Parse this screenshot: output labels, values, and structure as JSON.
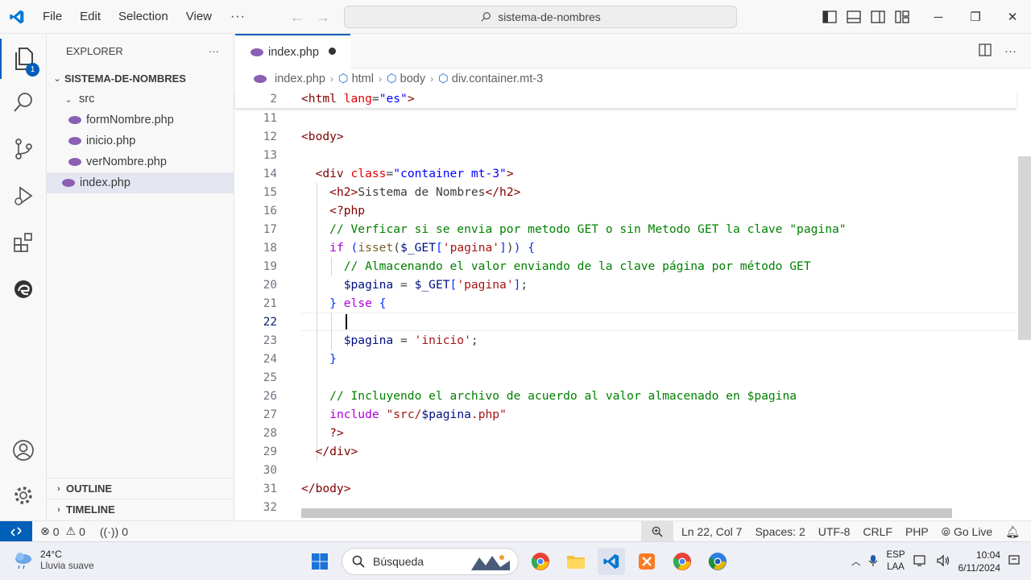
{
  "titlebar": {
    "menu": [
      "File",
      "Edit",
      "Selection",
      "View"
    ],
    "more": "···",
    "search_text": "sistema-de-nombres"
  },
  "activity": {
    "explorer_badge": "1"
  },
  "sidebar": {
    "header": "EXPLORER",
    "header_more": "···",
    "root": "SISTEMA-DE-NOMBRES",
    "folder": "src",
    "files": [
      "formNombre.php",
      "inicio.php",
      "verNombre.php"
    ],
    "root_file": "index.php",
    "outline": "OUTLINE",
    "timeline": "TIMELINE"
  },
  "editor": {
    "tab_label": "index.php",
    "breadcrumb": [
      "index.php",
      "html",
      "body",
      "div.container.mt-3"
    ],
    "lines": [
      {
        "n": "2",
        "html": "<span class=\"tag\">&lt;html</span> <span class=\"attr\">lang</span>=<span class=\"str\">\"es\"</span><span class=\"tag\">&gt;</span>"
      },
      {
        "n": "11",
        "html": ""
      },
      {
        "n": "12",
        "html": "<span class=\"tag\">&lt;body&gt;</span>"
      },
      {
        "n": "13",
        "html": ""
      },
      {
        "n": "14",
        "html": "  <span class=\"tag\">&lt;div</span> <span class=\"attr\">class</span>=<span class=\"str\">\"container mt-3\"</span><span class=\"tag\">&gt;</span>"
      },
      {
        "n": "15",
        "html": "    <span class=\"tag\">&lt;h2&gt;</span>Sistema de Nombres<span class=\"tag\">&lt;/h2&gt;</span>"
      },
      {
        "n": "16",
        "html": "    <span class=\"tag\">&lt;?php</span>"
      },
      {
        "n": "17",
        "html": "    <span class=\"cmt\">// Verficar si se envia por metodo GET o sin Metodo GET la clave \"pagina\"</span>"
      },
      {
        "n": "18",
        "html": "    <span class=\"kw\">if</span> <span class=\"brace\">(</span><span class=\"fn\">isset</span>(<span class=\"var\">$_GET</span><span class=\"brace\">[</span><span class=\"sq\">'pagina'</span><span class=\"brace\">]</span>)<span class=\"brace\">)</span> <span class=\"brace\">{</span>"
      },
      {
        "n": "19",
        "html": "      <span class=\"cmt\">// Almacenando el valor enviando de la clave página por método GET</span>"
      },
      {
        "n": "20",
        "html": "      <span class=\"var\">$pagina</span> = <span class=\"var\">$_GET</span><span class=\"brace\">[</span><span class=\"sq\">'pagina'</span><span class=\"brace\">]</span>;"
      },
      {
        "n": "21",
        "html": "    <span class=\"brace\">}</span> <span class=\"kw\">else</span> <span class=\"brace\">{</span>"
      },
      {
        "n": "22",
        "html": ""
      },
      {
        "n": "23",
        "html": "      <span class=\"var\">$pagina</span> = <span class=\"sq\">'inicio'</span>;"
      },
      {
        "n": "24",
        "html": "    <span class=\"brace\">}</span>"
      },
      {
        "n": "25",
        "html": ""
      },
      {
        "n": "26",
        "html": "    <span class=\"cmt\">// Incluyendo el archivo de acuerdo al valor almacenado en $pagina</span>"
      },
      {
        "n": "27",
        "html": "    <span class=\"kw\">include</span> <span class=\"sq\">\"src/</span><span class=\"var\">$pagina</span><span class=\"sq\">.php\"</span>"
      },
      {
        "n": "28",
        "html": "    <span class=\"tag\">?&gt;</span>"
      },
      {
        "n": "29",
        "html": "  <span class=\"tag\">&lt;/div&gt;</span>"
      },
      {
        "n": "30",
        "html": ""
      },
      {
        "n": "31",
        "html": "<span class=\"tag\">&lt;/body&gt;</span>"
      },
      {
        "n": "32",
        "html": ""
      }
    ]
  },
  "statusbar": {
    "errors": "0",
    "warnings": "0",
    "ports": "0",
    "position": "Ln 22, Col 7",
    "spaces": "Spaces: 2",
    "encoding": "UTF-8",
    "eol": "CRLF",
    "language": "PHP",
    "golive": "Go Live"
  },
  "taskbar": {
    "temp": "24°C",
    "weather": "Lluvia suave",
    "search_placeholder": "Búsqueda",
    "lang_top": "ESP",
    "lang_bottom": "LAA",
    "time": "10:04",
    "date": "6/11/2024"
  }
}
